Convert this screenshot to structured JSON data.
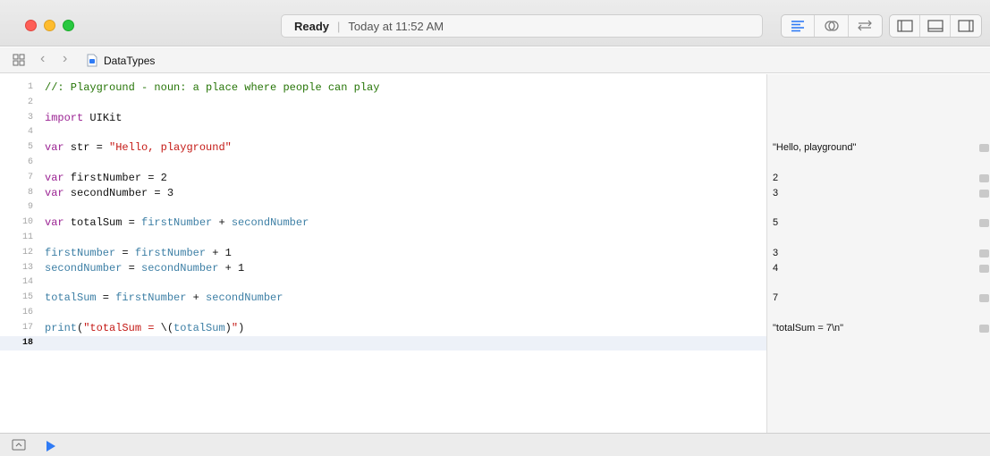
{
  "titlebar": {
    "status": "Ready",
    "time": "Today at 11:52 AM"
  },
  "jumpbar": {
    "file_name": "DataTypes"
  },
  "editor": {
    "lines": [
      {
        "num": "1",
        "tokens": [
          {
            "t": "//: Playground - noun: a place where people can play",
            "c": "c"
          }
        ]
      },
      {
        "num": "2",
        "tokens": []
      },
      {
        "num": "3",
        "tokens": [
          {
            "t": "import",
            "c": "k"
          },
          {
            "t": " UIKit",
            "c": "n"
          }
        ]
      },
      {
        "num": "4",
        "tokens": []
      },
      {
        "num": "5",
        "tokens": [
          {
            "t": "var",
            "c": "k"
          },
          {
            "t": " str = ",
            "c": "n"
          },
          {
            "t": "\"Hello, playground\"",
            "c": "s"
          }
        ]
      },
      {
        "num": "6",
        "tokens": []
      },
      {
        "num": "7",
        "tokens": [
          {
            "t": "var",
            "c": "k"
          },
          {
            "t": " firstNumber = 2",
            "c": "n"
          }
        ]
      },
      {
        "num": "8",
        "tokens": [
          {
            "t": "var",
            "c": "k"
          },
          {
            "t": " secondNumber = 3",
            "c": "n"
          }
        ]
      },
      {
        "num": "9",
        "tokens": []
      },
      {
        "num": "10",
        "tokens": [
          {
            "t": "var",
            "c": "k"
          },
          {
            "t": " totalSum = ",
            "c": "n"
          },
          {
            "t": "firstNumber",
            "c": "v"
          },
          {
            "t": " + ",
            "c": "n"
          },
          {
            "t": "secondNumber",
            "c": "v"
          }
        ]
      },
      {
        "num": "11",
        "tokens": []
      },
      {
        "num": "12",
        "tokens": [
          {
            "t": "firstNumber",
            "c": "v"
          },
          {
            "t": " = ",
            "c": "n"
          },
          {
            "t": "firstNumber",
            "c": "v"
          },
          {
            "t": " + 1",
            "c": "n"
          }
        ]
      },
      {
        "num": "13",
        "tokens": [
          {
            "t": "secondNumber",
            "c": "v"
          },
          {
            "t": " = ",
            "c": "n"
          },
          {
            "t": "secondNumber",
            "c": "v"
          },
          {
            "t": " + 1",
            "c": "n"
          }
        ]
      },
      {
        "num": "14",
        "tokens": []
      },
      {
        "num": "15",
        "tokens": [
          {
            "t": "totalSum",
            "c": "v"
          },
          {
            "t": " = ",
            "c": "n"
          },
          {
            "t": "firstNumber",
            "c": "v"
          },
          {
            "t": " + ",
            "c": "n"
          },
          {
            "t": "secondNumber",
            "c": "v"
          }
        ]
      },
      {
        "num": "16",
        "tokens": []
      },
      {
        "num": "17",
        "tokens": [
          {
            "t": "print",
            "c": "f"
          },
          {
            "t": "(",
            "c": "n"
          },
          {
            "t": "\"totalSum = ",
            "c": "s"
          },
          {
            "t": "\\(",
            "c": "n"
          },
          {
            "t": "totalSum",
            "c": "v"
          },
          {
            "t": ")",
            "c": "n"
          },
          {
            "t": "\"",
            "c": "s"
          },
          {
            "t": ")",
            "c": "n"
          }
        ]
      },
      {
        "num": "18",
        "tokens": [],
        "current": true
      }
    ]
  },
  "results": [
    {
      "line": 5,
      "value": "\"Hello, playground\""
    },
    {
      "line": 7,
      "value": "2"
    },
    {
      "line": 8,
      "value": "3"
    },
    {
      "line": 10,
      "value": "5"
    },
    {
      "line": 12,
      "value": "3"
    },
    {
      "line": 13,
      "value": "4"
    },
    {
      "line": 15,
      "value": "7"
    },
    {
      "line": 17,
      "value": "\"totalSum = 7\\n\""
    }
  ],
  "icons": {
    "toolbar_left": [
      "standard-editor-icon",
      "assistant-editor-icon",
      "version-editor-icon"
    ],
    "toolbar_right": [
      "navigator-panel-icon",
      "debug-panel-icon",
      "utilities-panel-icon"
    ]
  },
  "colors": {
    "keyword": "#9b2393",
    "string": "#c41a16",
    "comment": "#267507",
    "identifier": "#3d7fa5",
    "accent": "#2f7bf5"
  }
}
